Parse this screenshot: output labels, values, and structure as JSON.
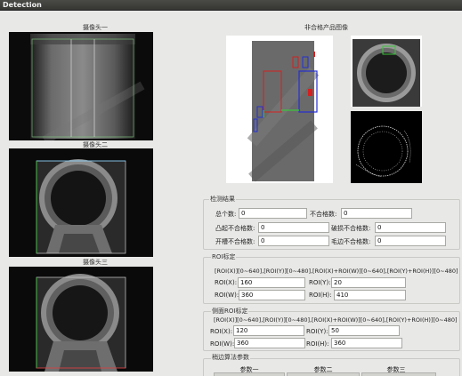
{
  "window": {
    "title": "Detection"
  },
  "cameras": [
    {
      "label": "摄像头一"
    },
    {
      "label": "摄像头二"
    },
    {
      "label": "摄像头三"
    }
  ],
  "defect_panel": {
    "title": "非合格产品图像"
  },
  "results": {
    "title": "检测结果",
    "total_label": "总个数:",
    "total_value": "0",
    "unqualified_label": "不合格数:",
    "unqualified_value": "0",
    "dent_label": "凸起不合格数:",
    "dent_value": "0",
    "break_label": "破损不合格数:",
    "break_value": "0",
    "groove_label": "开槽不合格数:",
    "groove_value": "0",
    "burr_label": "毛边不合格数:",
    "burr_value": "0"
  },
  "roi": {
    "title": "ROI标定",
    "hint": "[ROI(X)][0~640],[ROI(Y)][0~480],[ROI(X)+ROI(W)][0~640],[ROI(Y)+ROI(H)][0~480]",
    "x_label": "ROI(X):",
    "x_value": "160",
    "y_label": "ROI(Y):",
    "y_value": "20",
    "w_label": "ROI(W):",
    "w_value": "360",
    "h_label": "ROI(H):",
    "h_value": "410"
  },
  "side_roi": {
    "title": "侧面ROI标定",
    "hint": "[ROI(X)][0~640],[ROI(Y)][0~480],[ROI(X)+ROI(W)][0~640],[ROI(Y)+ROI(H)][0~480]",
    "x_label": "ROI(X):",
    "x_value": "120",
    "y_label": "ROI(Y):",
    "y_value": "50",
    "w_label": "ROI(W):",
    "w_value": "360",
    "h_label": "ROI(H):",
    "h_value": "360"
  },
  "edge_params": {
    "title": "稍边算法参数",
    "col1": "参数一",
    "col2": "参数二",
    "col3": "参数三"
  },
  "colors": {
    "roi_green": "#3ec43e",
    "roi_red": "#d42020",
    "roi_blue": "#2430d0"
  }
}
